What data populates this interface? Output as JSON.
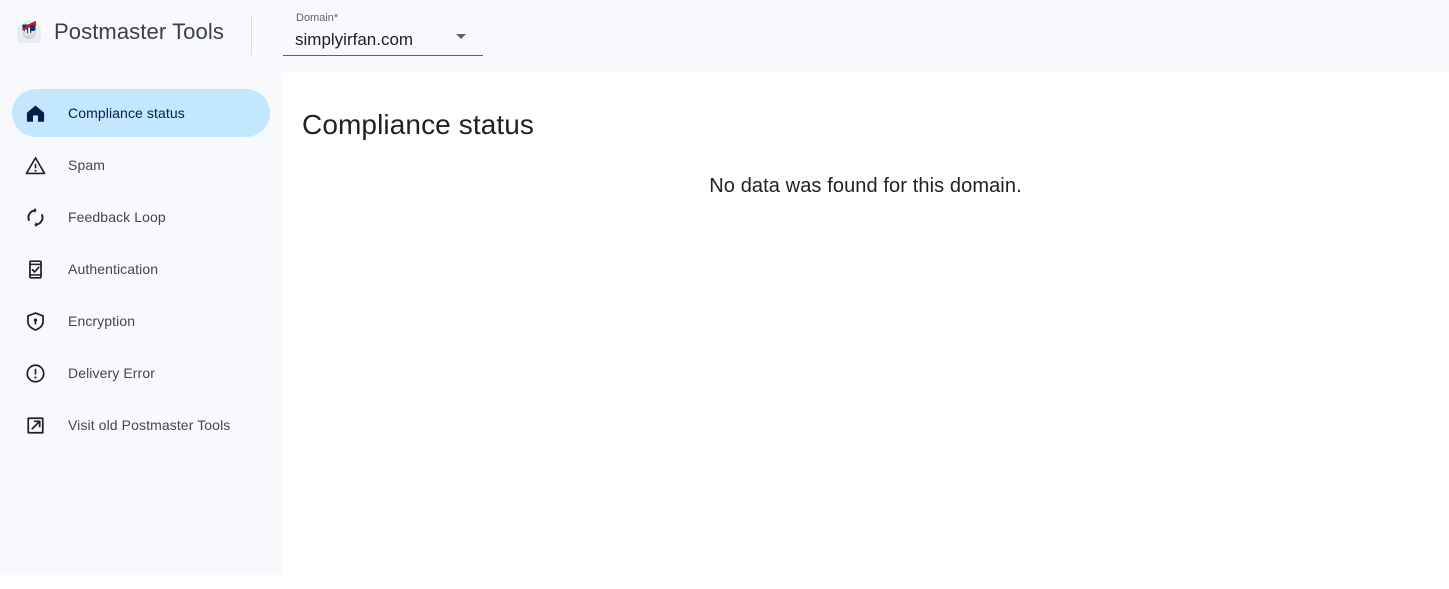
{
  "header": {
    "logo_icon": "postmaster-envelope-chart-logo",
    "title": "Postmaster Tools",
    "domain_selector": {
      "label": "Domain*",
      "value": "simplyirfan.com",
      "dropdown_icon": "chevron-down-icon"
    }
  },
  "sidebar": {
    "items": [
      {
        "label": "Compliance status",
        "icon": "home-icon",
        "active": true
      },
      {
        "label": "Spam",
        "icon": "warning-triangle-icon",
        "active": false
      },
      {
        "label": "Feedback Loop",
        "icon": "sync-loop-icon",
        "active": false
      },
      {
        "label": "Authentication",
        "icon": "phone-check-icon",
        "active": false
      },
      {
        "label": "Encryption",
        "icon": "shield-lock-icon",
        "active": false
      },
      {
        "label": "Delivery Error",
        "icon": "error-circle-icon",
        "active": false
      },
      {
        "label": "Visit old Postmaster Tools",
        "icon": "external-link-icon",
        "active": false
      }
    ]
  },
  "main": {
    "page_title": "Compliance status",
    "empty_message": "No data was found for this domain."
  },
  "colors": {
    "surface_tint": "#f7f9fc",
    "active_pill": "#c2e7ff",
    "active_text": "#041e49",
    "nav_text": "#444746",
    "title_text": "#202124",
    "divider": "#dadce0",
    "logo_blue": "#1a2e6e",
    "logo_red": "#c5221f"
  }
}
